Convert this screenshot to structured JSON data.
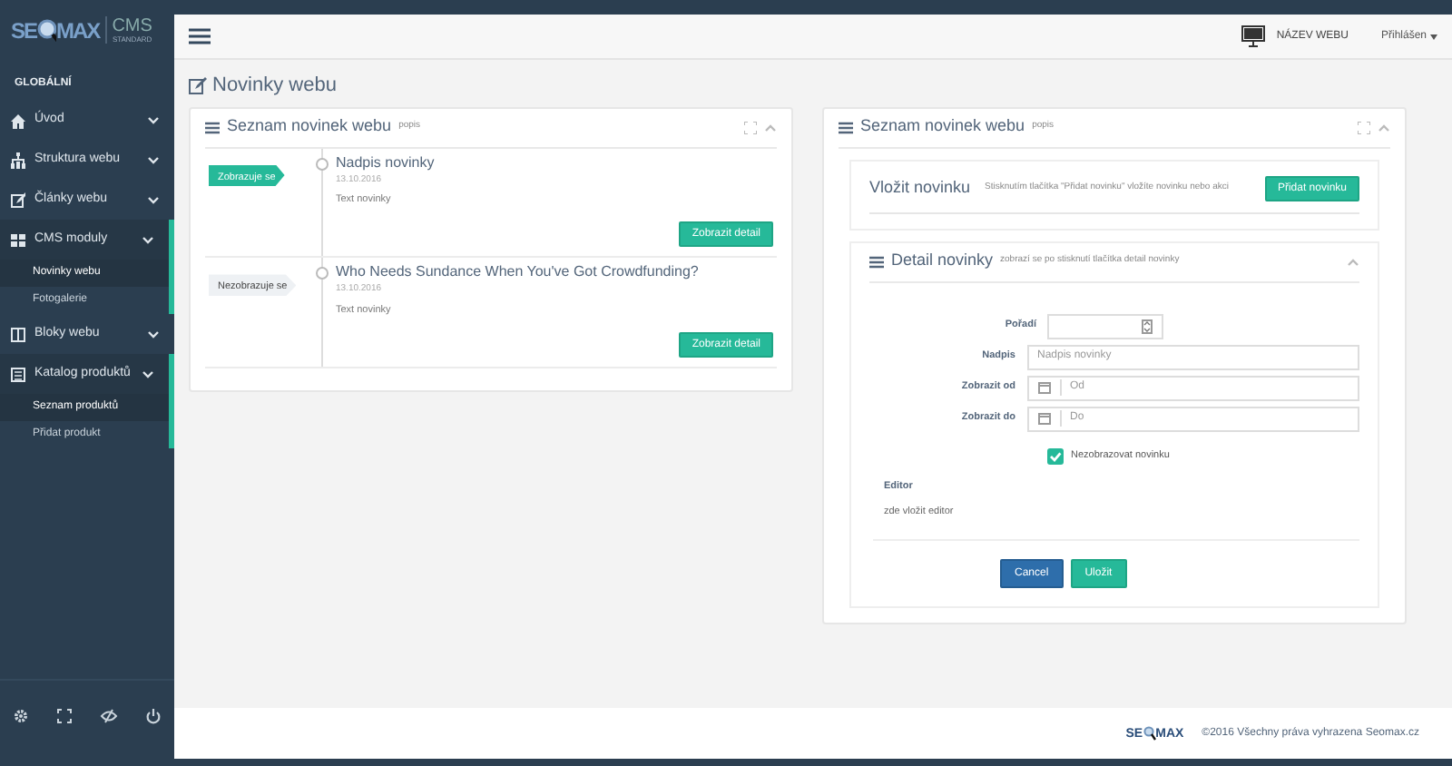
{
  "logo": {
    "left": "SE",
    "right": "MAX",
    "product": "CMS",
    "edition": "STANDARD"
  },
  "sidebar": {
    "section": "GLOBÁLNÍ",
    "items": [
      {
        "label": "Úvod",
        "expanded": false
      },
      {
        "label": "Struktura webu",
        "expanded": false
      },
      {
        "label": "Články webu",
        "expanded": false
      },
      {
        "label": "CMS moduly",
        "expanded": true,
        "children": [
          {
            "label": "Novinky webu",
            "selected": true
          },
          {
            "label": "Fotogalerie",
            "selected": false
          }
        ]
      },
      {
        "label": "Bloky webu",
        "expanded": false
      },
      {
        "label": "Katalog produktů",
        "expanded": true,
        "children": [
          {
            "label": "Seznam produktů",
            "selected": true
          },
          {
            "label": "Přidat produkt",
            "selected": false
          }
        ]
      }
    ]
  },
  "header": {
    "site_name": "NÁZEV WEBU",
    "user_menu": "Přihlášen"
  },
  "page_title": "Novinky webu",
  "news_panel": {
    "title": "Seznam novinek webu",
    "subtitle": "popis",
    "items": [
      {
        "status": "Zobrazuje se",
        "visible": true,
        "title": "Nadpis novinky",
        "date": "13.10.2016",
        "text": "Text novinky",
        "button": "Zobrazit detail"
      },
      {
        "status": "Nezobrazuje se",
        "visible": false,
        "title": "Who Needs Sundance When You've Got Crowdfunding?",
        "date": "13.10.2016",
        "text": "Text novinky",
        "button": "Zobrazit detail"
      }
    ]
  },
  "edit_panel": {
    "title": "Seznam novinek webu",
    "subtitle": "popis",
    "insert": {
      "title": "Vložit novinku",
      "description": "Stisknutím tlačítka \"Přidat novinku\" vložíte novinku nebo akci",
      "button": "Přidat novinku"
    },
    "detail": {
      "title": "Detail novinky",
      "subtitle": "zobrazí se po stisknutí tlačítka detail novinky",
      "fields": [
        {
          "kind": "number",
          "label": "Pořadí"
        },
        {
          "kind": "text",
          "label": "Nadpis",
          "placeholder": "Nadpis novinky"
        },
        {
          "kind": "date",
          "label": "Zobrazit od",
          "placeholder": "Od"
        },
        {
          "kind": "date",
          "label": "Zobrazit do",
          "placeholder": "Do"
        }
      ],
      "checkbox": {
        "label": "Nezobrazovat novinku",
        "checked": true
      },
      "editor_label": "Editor",
      "editor_placeholder": "zde vložit editor",
      "buttons": [
        {
          "kind": "secondary",
          "label": "Cancel"
        },
        {
          "kind": "primary",
          "label": "Uložit"
        }
      ]
    }
  },
  "footer": {
    "logo_left": "SE",
    "logo_right": "MAX",
    "copyright": "©2016 Všechny práva vyhrazena Seomax.cz"
  }
}
